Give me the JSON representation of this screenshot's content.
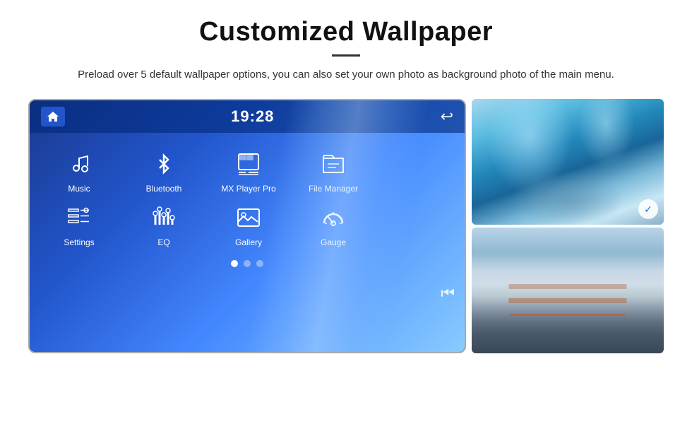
{
  "page": {
    "title": "Customized Wallpaper",
    "subtitle": "Preload over 5 default wallpaper options, you can also set your own photo as background photo of the main menu.",
    "divider_visible": true
  },
  "car_ui": {
    "time": "19:28",
    "apps_row1": [
      {
        "id": "music",
        "label": "Music",
        "icon": "music"
      },
      {
        "id": "bluetooth",
        "label": "Bluetooth",
        "icon": "bluetooth"
      },
      {
        "id": "mx-player",
        "label": "MX Player Pro",
        "icon": "mx-player"
      },
      {
        "id": "file-manager",
        "label": "File Manager",
        "icon": "file-manager"
      }
    ],
    "apps_row2": [
      {
        "id": "settings",
        "label": "Settings",
        "icon": "settings"
      },
      {
        "id": "eq",
        "label": "EQ",
        "icon": "eq"
      },
      {
        "id": "gallery",
        "label": "Gallery",
        "icon": "gallery"
      },
      {
        "id": "gauge",
        "label": "Gauge",
        "icon": "gauge"
      }
    ],
    "dots": [
      {
        "active": true
      },
      {
        "active": false
      },
      {
        "active": false
      }
    ]
  },
  "photos": {
    "top": {
      "alt": "Ice cave blue photo",
      "badge": "✓"
    },
    "bottom": {
      "alt": "Golden Gate Bridge foggy photo"
    }
  }
}
